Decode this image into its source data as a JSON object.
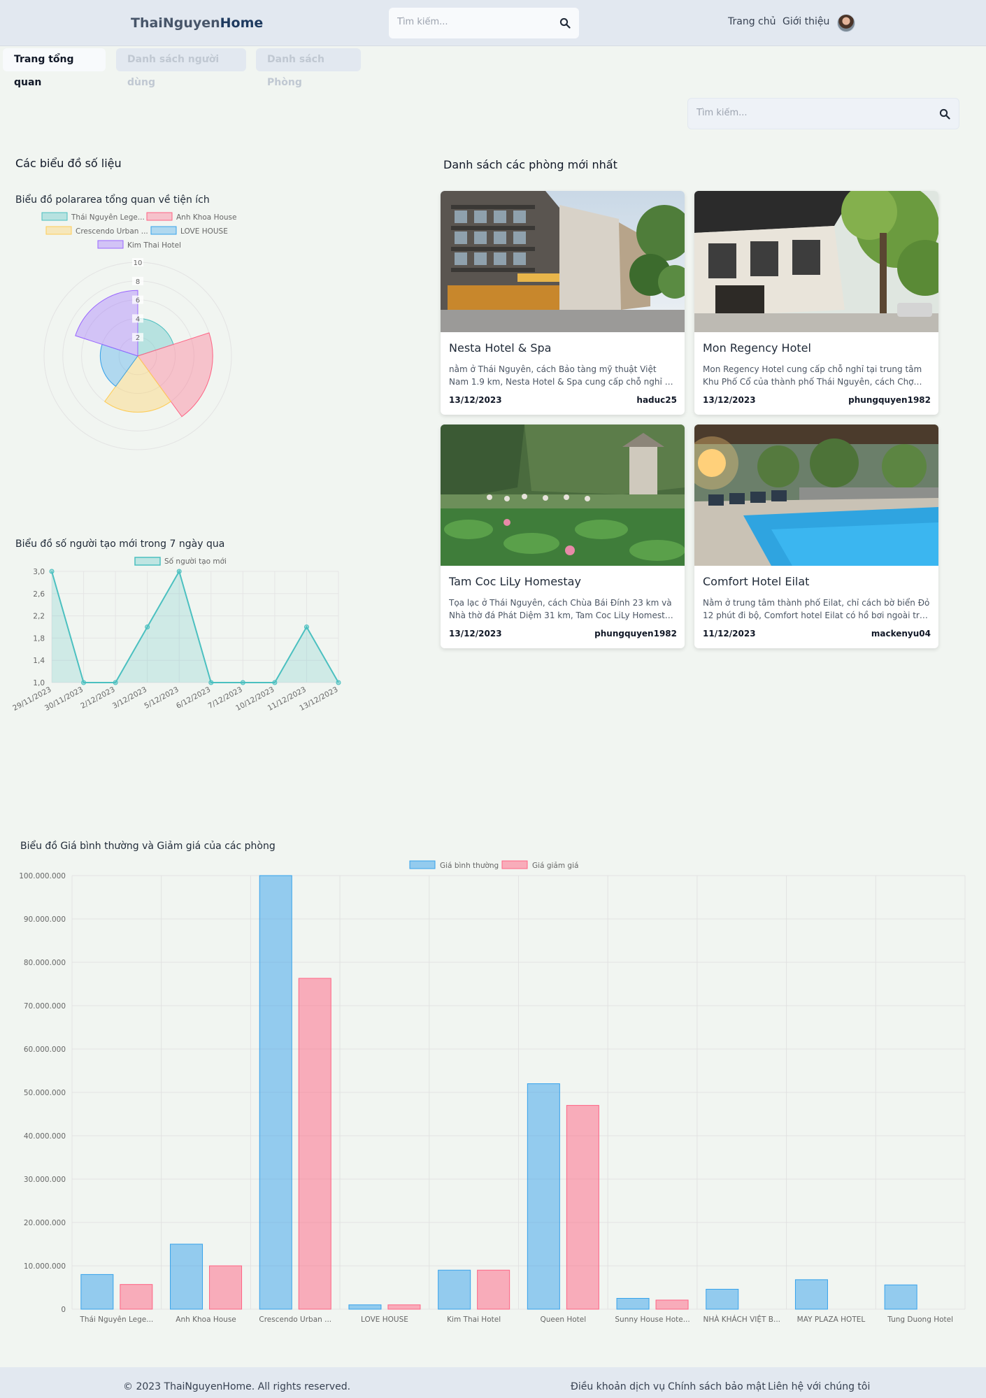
{
  "header": {
    "logo_part1": "ThaiNguyen",
    "logo_part2": "Home",
    "search_placeholder": "Tìm kiếm...",
    "nav_home": "Trang chủ",
    "nav_about": "Giới thiệu"
  },
  "tabs": [
    {
      "label": "Trang tổng quan",
      "active": true
    },
    {
      "label": "Danh sách người dùng",
      "active": false
    },
    {
      "label": "Danh sách Phòng",
      "active": false
    }
  ],
  "main_search_placeholder": "Tìm kiếm...",
  "charts_section_title": "Các biểu đồ số liệu",
  "rooms_section_title": "Danh sách các phòng mới nhất",
  "chart_data": [
    {
      "type": "polarArea",
      "title": "Biểu đồ polararea tổng quan về tiện ích",
      "legend_position": "top",
      "categories": [
        "Thái Nguyên Lege...",
        "Anh Khoa House",
        "Crescendo Urban ...",
        "LOVE HOUSE",
        "Kim Thai Hotel"
      ],
      "values": [
        4,
        8,
        6,
        4,
        7
      ],
      "r_ticks": [
        "2",
        "4",
        "6",
        "8",
        "10"
      ],
      "r_max": 10,
      "colors": [
        "#4bc0c0",
        "#ff6384",
        "#ffcd56",
        "#36a2eb",
        "#9966ff"
      ]
    },
    {
      "type": "line",
      "title": "Biểu đồ số người tạo mới trong 7 ngày qua",
      "legend_position": "top",
      "series": [
        {
          "name": "Số người tạo mới",
          "values": [
            3,
            1,
            1,
            2,
            3,
            1,
            1,
            1,
            2,
            1
          ]
        }
      ],
      "x": [
        "29/11/2023",
        "30/11/2023",
        "2/12/2023",
        "3/12/2023",
        "5/12/2023",
        "6/12/2023",
        "7/12/2023",
        "10/12/2023",
        "11/12/2023",
        "13/12/2023"
      ],
      "y_ticks": [
        "1,0",
        "1,4",
        "1,8",
        "2,2",
        "2,6",
        "3,0"
      ],
      "ylim": [
        1,
        3
      ],
      "color": "#4bc0c0",
      "grid": true
    },
    {
      "type": "bar",
      "title": "Biểu đồ Giá bình thường và Giảm giá của các phòng",
      "legend_position": "top",
      "categories": [
        "Thái Nguyên Lege...",
        "Anh Khoa House",
        "Crescendo Urban ...",
        "LOVE HOUSE",
        "Kim Thai Hotel",
        "Queen Hotel",
        "Sunny House Hote...",
        "NHÀ KHÁCH VIỆT B...",
        "MAY PLAZA HOTEL",
        "Tung Duong Hotel"
      ],
      "series": [
        {
          "name": "Giá bình thường",
          "values": [
            8000000,
            15000000,
            100000000,
            1000000,
            9000000,
            52000000,
            2500000,
            4600000,
            6800000,
            5600000
          ],
          "color": "#36a2eb"
        },
        {
          "name": "Giá giảm giá",
          "values": [
            5700000,
            10000000,
            76300000,
            1000000,
            9000000,
            47000000,
            2100000,
            0,
            0,
            0
          ],
          "color": "#ff6384"
        }
      ],
      "y_ticks": [
        "0",
        "10.000.000",
        "20.000.000",
        "30.000.000",
        "40.000.000",
        "50.000.000",
        "60.000.000",
        "70.000.000",
        "80.000.000",
        "90.000.000",
        "100.000.000"
      ],
      "ylim": [
        0,
        100000000
      ],
      "grid": true
    }
  ],
  "rooms": [
    {
      "title": "Nesta Hotel & Spa",
      "description": "nằm ở Thái Nguyên, cách Bảo tàng mỹ thuật Việt Nam 1.9 km, Nesta Hotel & Spa cung cấp chỗ nghỉ có xe đạp miễn phí",
      "date": "13/12/2023",
      "user": "haduc25",
      "image": "hotel-facade-photo"
    },
    {
      "title": "Mon Regency Hotel",
      "description": "Mon Regency Hotel cung cấp chỗ nghỉ tại trung tâm Khu Phố Cổ của thành phố Thái Nguyên, cách Chợ Đồng Xuân",
      "date": "13/12/2023",
      "user": "phungquyen1982",
      "image": "hotel-entrance-trees-photo"
    },
    {
      "title": "Tam Coc LiLy Homestay",
      "description": "Tọa lạc ở Thái Nguyên, cách Chùa Bái Đính 23 km và Nhà thờ đá Phát Diệm 31 km, Tam Coc LiLy Homestay cung cấp",
      "date": "13/12/2023",
      "user": "phungquyen1982",
      "image": "lotus-pond-pagoda-photo"
    },
    {
      "title": "Comfort Hotel Eilat",
      "description": "Nằm ở trung tâm thành phố Eilat, chỉ cách bờ biển Đỏ 12 phút đi bộ, Comfort hotel Eilat có hồ bơi ngoài trời với",
      "date": "11/12/2023",
      "user": "mackenyu04",
      "image": "pool-sunset-photo"
    }
  ],
  "footer": {
    "copyright": "© 2023 ThaiNguyenHome. All rights reserved.",
    "links": [
      "Điều khoản dịch vụ",
      "Chính sách bảo mật",
      "Liên hệ với chúng tôi"
    ]
  }
}
